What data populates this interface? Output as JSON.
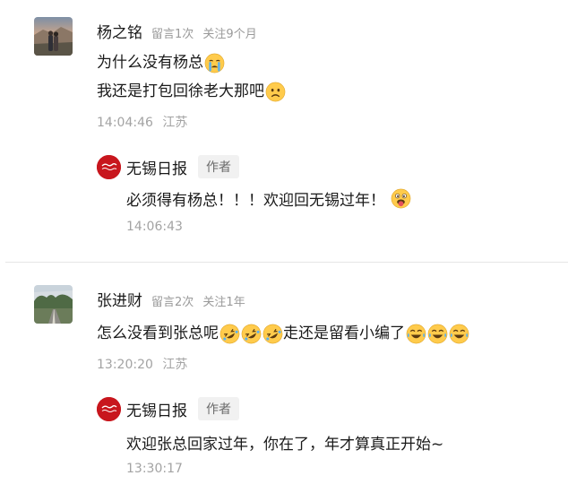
{
  "comments": [
    {
      "name": "杨之铭",
      "message_count": "留言1次",
      "follow_duration": "关注9个月",
      "lines": [
        "为什么没有杨总",
        "我还是打包回徐老大那吧"
      ],
      "time": "14:04:46",
      "location": "江苏",
      "reply": {
        "name": "无锡日报",
        "tag": "作者",
        "text": "必须得有杨总！！！欢迎回无锡过年！",
        "time": "14:06:43"
      }
    },
    {
      "name": "张进财",
      "message_count": "留言2次",
      "follow_duration": "关注1年",
      "text_part1": "怎么没看到张总呢",
      "text_part2": "走还是留看小编了",
      "time": "13:20:20",
      "location": "江苏",
      "reply": {
        "name": "无锡日报",
        "tag": "作者",
        "text": "欢迎张总回家过年，你在了，年才算真正开始~",
        "time": "13:30:17"
      }
    }
  ],
  "emoji_icons": {
    "crying": "crying-face-icon",
    "frown": "frowning-face-icon",
    "tongue": "tongue-out-face-icon",
    "laugh_tears": "laughing-tears-face-icon",
    "rolling_laugh": "rolling-laugh-face-icon"
  },
  "colors": {
    "brand_red": "#c8161d",
    "meta_gray": "#9a9a9a",
    "tag_bg": "#f1f1f1"
  }
}
